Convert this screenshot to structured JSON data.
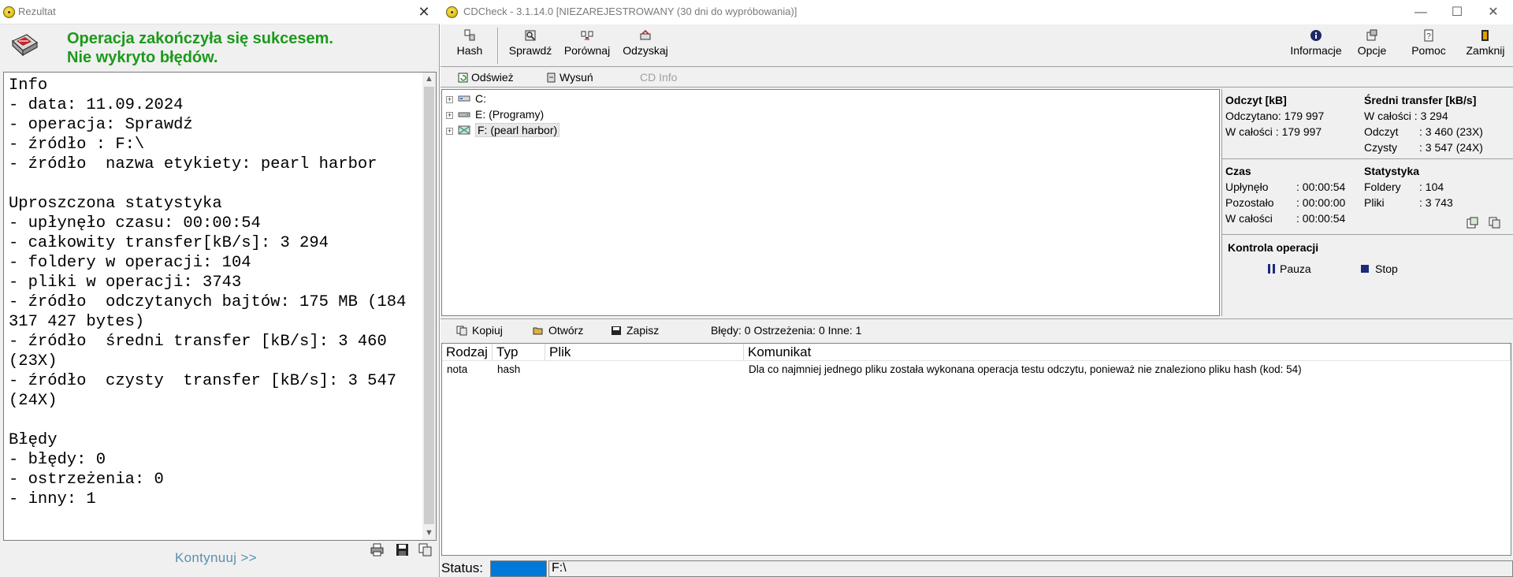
{
  "result_dialog": {
    "title": "Rezultat",
    "close_glyph": "✕",
    "status_line1": "Operacja zakończyła się sukcesem.",
    "status_line2": "Nie wykryto błędów.",
    "report_text": "Info\n- data: 11.09.2024\n- operacja: Sprawdź\n- źródło : F:\\\n- źródło  nazwa etykiety: pearl harbor\n\nUproszczona statystyka\n- upłynęło czasu: 00:00:54\n- całkowity transfer[kB/s]: 3 294\n- foldery w operacji: 104\n- pliki w operacji: 3743\n- źródło  odczytanych bajtów: 175 MB (184 317 427 bytes)\n- źródło  średni transfer [kB/s]: 3 460 (23X)\n- źródło  czysty  transfer [kB/s]: 3 547 (24X)\n\nBłędy\n- błędy: 0\n- ostrzeżenia: 0\n- inny: 1",
    "continue_label": "Kontynuuj >>",
    "icons": [
      "disk-warning-icon",
      "print-icon",
      "save-icon",
      "copy-icon"
    ]
  },
  "main_window": {
    "title": "CDCheck - 3.1.14.0 [NIEZAREJESTROWANY (30 dni do wypróbowania)]",
    "window_controls": {
      "minimize": "—",
      "maximize": "☐",
      "close": "✕"
    },
    "toolbar": {
      "left": [
        {
          "id": "hash",
          "label": "Hash",
          "icon": "hash-icon"
        },
        {
          "id": "check",
          "label": "Sprawdź",
          "icon": "check-icon"
        },
        {
          "id": "compare",
          "label": "Porównaj",
          "icon": "compare-icon"
        },
        {
          "id": "recover",
          "label": "Odzyskaj",
          "icon": "recover-icon"
        }
      ],
      "right": [
        {
          "id": "info",
          "label": "Informacje",
          "icon": "info-icon"
        },
        {
          "id": "options",
          "label": "Opcje",
          "icon": "options-icon"
        },
        {
          "id": "help",
          "label": "Pomoc",
          "icon": "help-icon"
        },
        {
          "id": "close",
          "label": "Zamknij",
          "icon": "exit-icon"
        }
      ]
    },
    "toolbar2": {
      "refresh": "Odśwież",
      "eject": "Wysuń",
      "cd_info": "CD Info"
    },
    "tree": [
      {
        "label": "C:",
        "icon": "network-drive-icon"
      },
      {
        "label": "E: (Programy)",
        "icon": "hard-drive-icon"
      },
      {
        "label": "F: (pearl harbor)",
        "icon": "cd-drive-icon",
        "selected": true
      }
    ],
    "stats": {
      "read_header": "Odczyt [kB]",
      "read_value": "Odczytano: 179 997",
      "read_total": "W całości  : 179 997",
      "avg_header": "Średni transfer [kB/s]",
      "avg_total": "W całości : 3 294",
      "avg_read_label": "Odczyt",
      "avg_read_value": ": 3 460 (23X)",
      "avg_clean_label": "Czysty",
      "avg_clean_value": ": 3 547 (24X)",
      "time_header": "Czas",
      "elapsed_label": "Upłynęło",
      "elapsed_value": ": 00:00:54",
      "remaining_label": "Pozostało",
      "remaining_value": ": 00:00:00",
      "total_label": "W całości",
      "total_value": ": 00:00:54",
      "statistics_header": "Statystyka",
      "folders_label": "Foldery",
      "folders_value": ": 104",
      "files_label": "Pliki",
      "files_value": ": 3 743",
      "control_header": "Kontrola operacji",
      "pause_label": "Pauza",
      "stop_label": "Stop"
    },
    "toolbar3": {
      "copy": "Kopiuj",
      "open": "Otwórz",
      "save": "Zapisz",
      "summary": "Błędy: 0 Ostrzeżenia: 0 Inne: 1"
    },
    "messages": {
      "columns": [
        "Rodzaj",
        "Typ",
        "Plik",
        "Komunikat"
      ],
      "rows": [
        {
          "kind": "nota",
          "type": "hash",
          "file": "",
          "message": "Dla co najmniej jednego pliku została wykonana operacja testu odczytu, ponieważ nie znaleziono pliku hash (kod: 54)"
        }
      ]
    },
    "status": {
      "label": "Status:",
      "progress_fraction": 1.0,
      "path": "F:\\"
    }
  }
}
